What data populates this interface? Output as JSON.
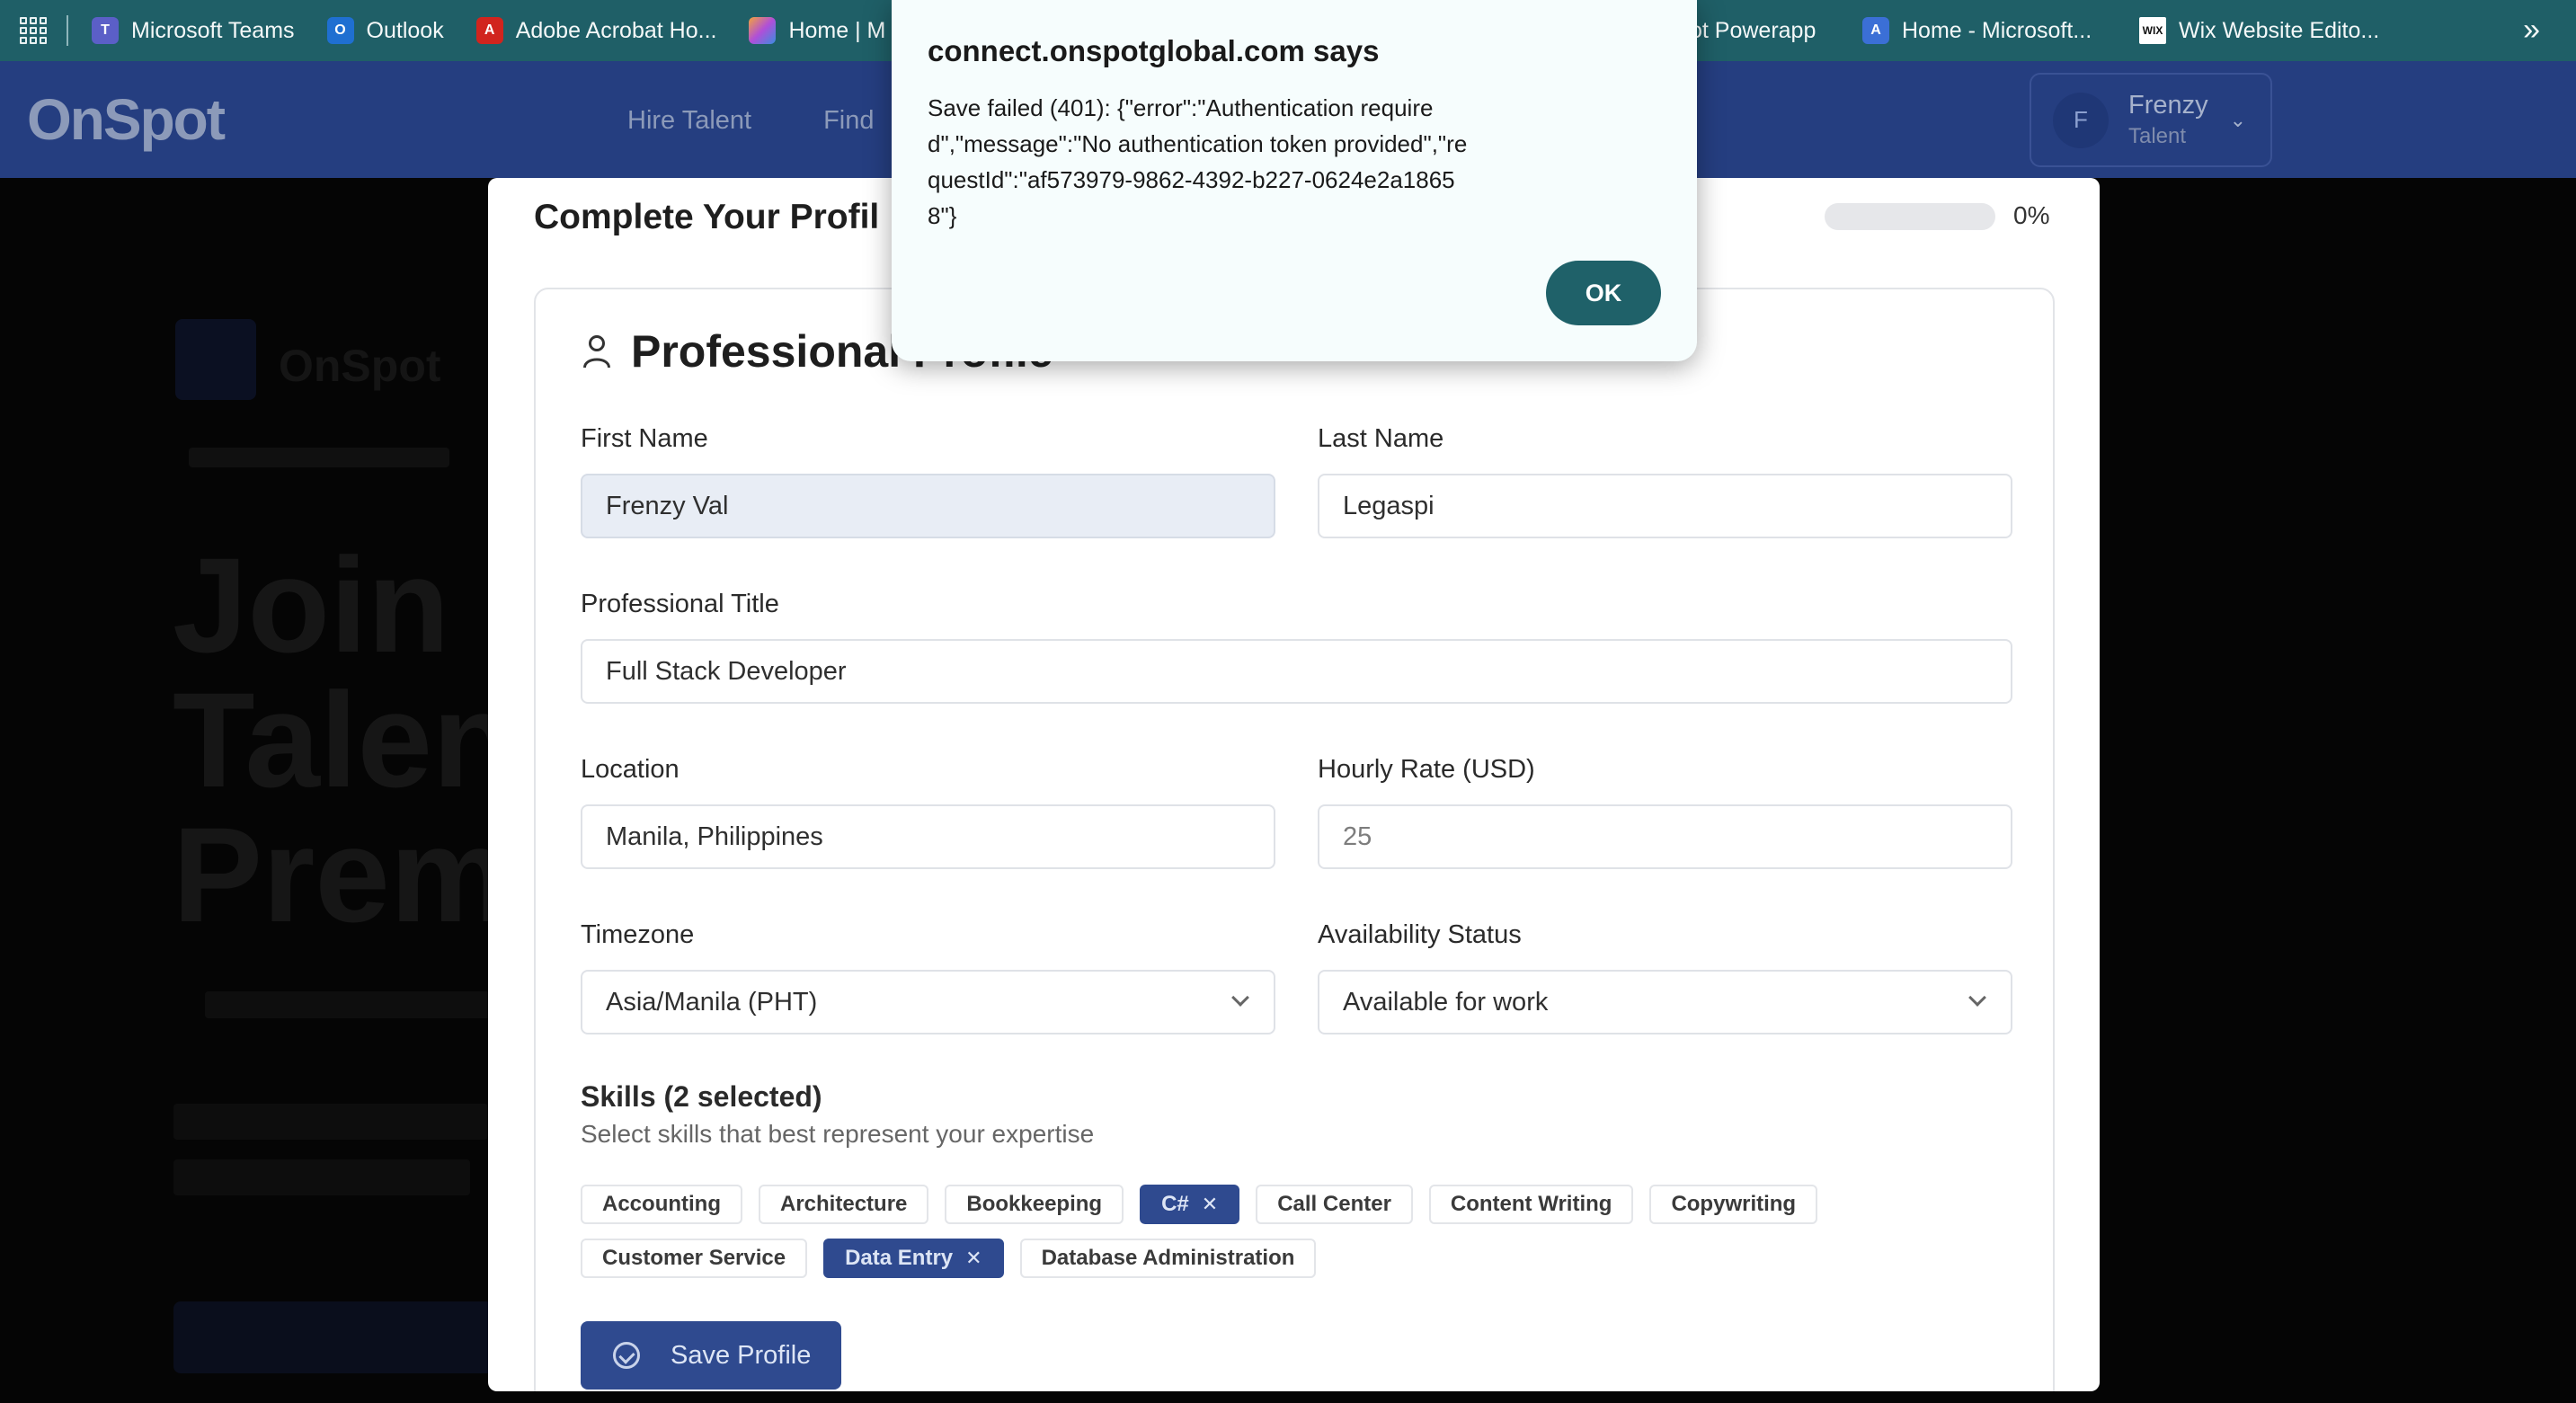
{
  "bookmarks": {
    "items": [
      {
        "label": "Microsoft Teams",
        "icon": "teams-icon",
        "color": "#5b5fc7"
      },
      {
        "label": "Outlook",
        "icon": "outlook-icon",
        "color": "#1f6fd1"
      },
      {
        "label": "Adobe Acrobat Ho...",
        "icon": "acrobat-icon",
        "color": "#d1241e"
      },
      {
        "label": "Home | M",
        "icon": "copilot-icon",
        "color": "#b04fd8"
      }
    ],
    "items_right": [
      {
        "label": "ot Powerapp",
        "icon": "",
        "color": ""
      },
      {
        "label": "Home - Microsoft...",
        "icon": "microsoft-icon",
        "color": "#3b6fd6"
      },
      {
        "label": "Wix Website Edito...",
        "icon": "wix-icon",
        "color": "#ffffff"
      }
    ],
    "more": "»"
  },
  "header": {
    "logo": "OnSpot",
    "nav": [
      "Hire Talent",
      "Find"
    ],
    "user": {
      "initial": "F",
      "name": "Frenzy",
      "role": "Talent"
    }
  },
  "background": {
    "logo_text": "OnSpot",
    "headline": "Join \nTalen\nPrem"
  },
  "modal": {
    "title": "Complete Your Profil",
    "progress_percent": 0,
    "progress_label": "0%",
    "section_title": "Professional Profile",
    "fields": {
      "first_name": {
        "label": "First Name",
        "value": "Frenzy Val"
      },
      "last_name": {
        "label": "Last Name",
        "value": "Legaspi"
      },
      "title": {
        "label": "Professional Title",
        "value": "Full Stack Developer"
      },
      "location": {
        "label": "Location",
        "value": "Manila, Philippines"
      },
      "rate": {
        "label": "Hourly Rate (USD)",
        "placeholder": "25"
      },
      "timezone": {
        "label": "Timezone",
        "value": "Asia/Manila (PHT)"
      },
      "availability": {
        "label": "Availability Status",
        "value": "Available for work"
      }
    },
    "skills": {
      "title": "Skills (2 selected)",
      "subtitle": "Select skills that best represent your expertise",
      "items": [
        {
          "label": "Accounting",
          "selected": false
        },
        {
          "label": "Architecture",
          "selected": false
        },
        {
          "label": "Bookkeeping",
          "selected": false
        },
        {
          "label": "C#",
          "selected": true
        },
        {
          "label": "Call Center",
          "selected": false
        },
        {
          "label": "Content Writing",
          "selected": false
        },
        {
          "label": "Copywriting",
          "selected": false
        },
        {
          "label": "Customer Service",
          "selected": false
        },
        {
          "label": "Data Entry",
          "selected": true
        },
        {
          "label": "Database Administration",
          "selected": false
        }
      ]
    },
    "save_label": "Save Profile"
  },
  "alert": {
    "title": "connect.onspotglobal.com says",
    "message": "Save failed (401): {\"error\":\"Authentication required\",\"message\":\"No authentication token provided\",\"requestId\":\"af573979-9862-4392-b227-0624e2a18658\"}",
    "ok_label": "OK"
  },
  "colors": {
    "brand": "#253e80",
    "primary_button": "#2f4a8f",
    "alert_ok": "#1f6169",
    "bookmarks_bar": "#1f5f67"
  }
}
